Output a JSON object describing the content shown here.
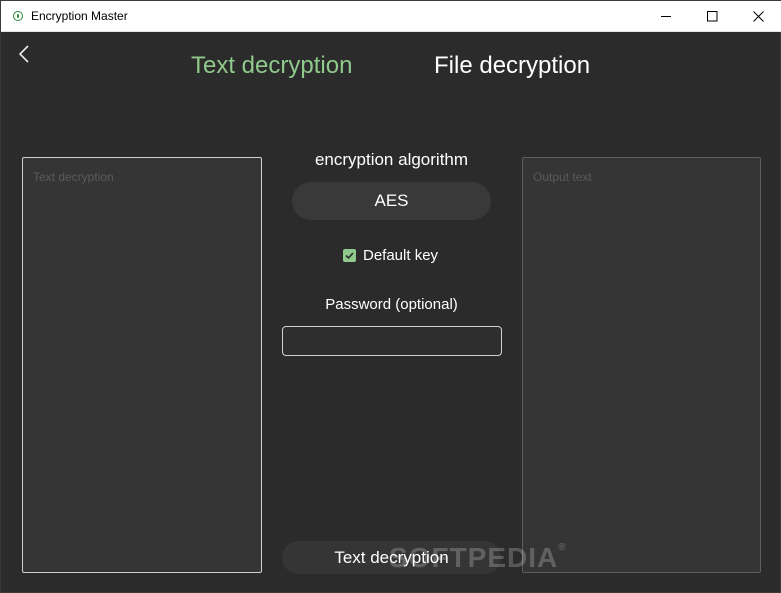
{
  "window": {
    "title": "Encryption Master",
    "controls": {
      "minimize": "minimize-icon",
      "maximize": "maximize-icon",
      "close": "close-icon"
    }
  },
  "nav": {
    "back_icon": "chevron-left-icon",
    "tabs": [
      {
        "label": "Text decryption",
        "active": true,
        "color": "#8fc98c"
      },
      {
        "label": "File decryption",
        "active": false,
        "color": "#ffffff"
      }
    ]
  },
  "input": {
    "placeholder": "Text decryption",
    "value": ""
  },
  "settings": {
    "algorithm_label": "encryption algorithm",
    "algorithm_value": "AES",
    "default_key_label": "Default key",
    "default_key_checked": true,
    "password_label": "Password (optional)",
    "password_value": ""
  },
  "output": {
    "placeholder": "Output text",
    "value": ""
  },
  "action": {
    "label": "Text decryption"
  },
  "watermark": {
    "text": "SOFTPEDIA",
    "mark": "®"
  },
  "colors": {
    "accent": "#8fc98c",
    "background": "#2b2b2b",
    "titlebar": "#ffffff"
  }
}
